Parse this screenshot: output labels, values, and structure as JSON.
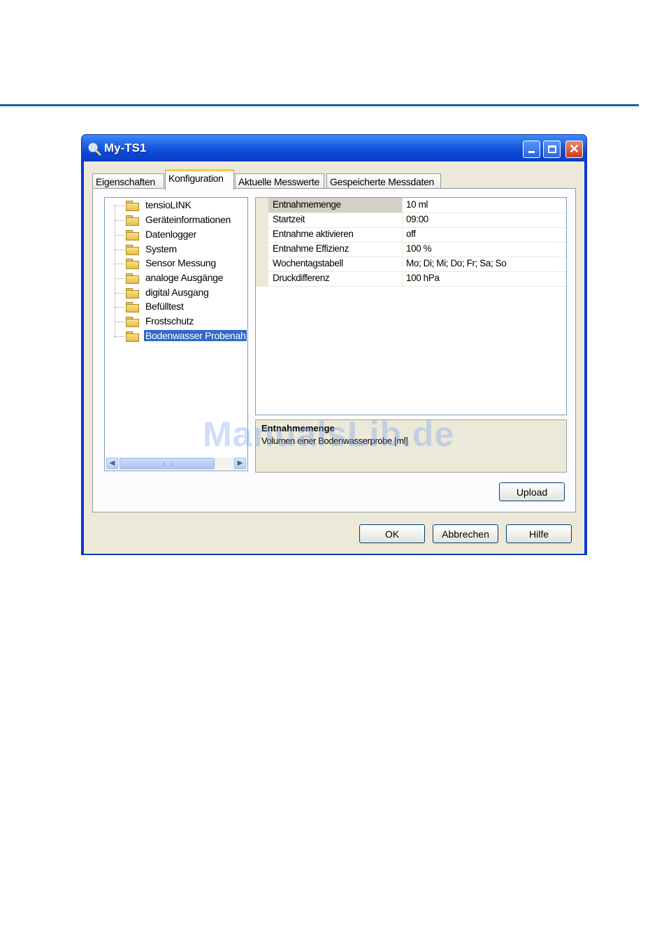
{
  "window": {
    "title": "My-TS1",
    "app_icon": "magnifier-icon"
  },
  "tabs": [
    {
      "label": "Eigenschaften",
      "active": false
    },
    {
      "label": "Konfiguration",
      "active": true
    },
    {
      "label": "Aktuelle Messwerte",
      "active": false
    },
    {
      "label": "Gespeicherte Messdaten",
      "active": false
    }
  ],
  "tree": {
    "items": [
      {
        "label": "tensioLINK"
      },
      {
        "label": "Geräteinformationen"
      },
      {
        "label": "Datenlogger"
      },
      {
        "label": "System"
      },
      {
        "label": "Sensor Messung"
      },
      {
        "label": "analoge Ausgänge"
      },
      {
        "label": "digital Ausgang"
      },
      {
        "label": "Befülltest"
      },
      {
        "label": "Frostschutz"
      },
      {
        "label": "Bodenwasser Probenah",
        "selected": true
      }
    ],
    "scroll_grip": "III"
  },
  "properties": [
    {
      "name": "Entnahmemenge",
      "value": "10 ml",
      "selected": true
    },
    {
      "name": "Startzeit",
      "value": "09:00"
    },
    {
      "name": "Entnahme aktivieren",
      "value": "off"
    },
    {
      "name": "Entnahme Effizienz",
      "value": "100 %"
    },
    {
      "name": "Wochentagstabell",
      "value": "Mo; Di; Mi; Do; Fr; Sa; So"
    },
    {
      "name": "Druckdifferenz",
      "value": "100 hPa"
    }
  ],
  "help_panel": {
    "title": "Entnahmemenge",
    "description": "Volumen einer Bodenwasserprobe [ml]"
  },
  "buttons": {
    "upload": "Upload",
    "ok": "OK",
    "cancel": "Abbrechen",
    "help": "Hilfe"
  },
  "watermark": "ManualsLib.de",
  "colors": {
    "title_bar": "#0a46d3",
    "selection": "#316ac5",
    "active_tab_accent": "#ffc83c",
    "page_rule": "#1f5ea8"
  }
}
